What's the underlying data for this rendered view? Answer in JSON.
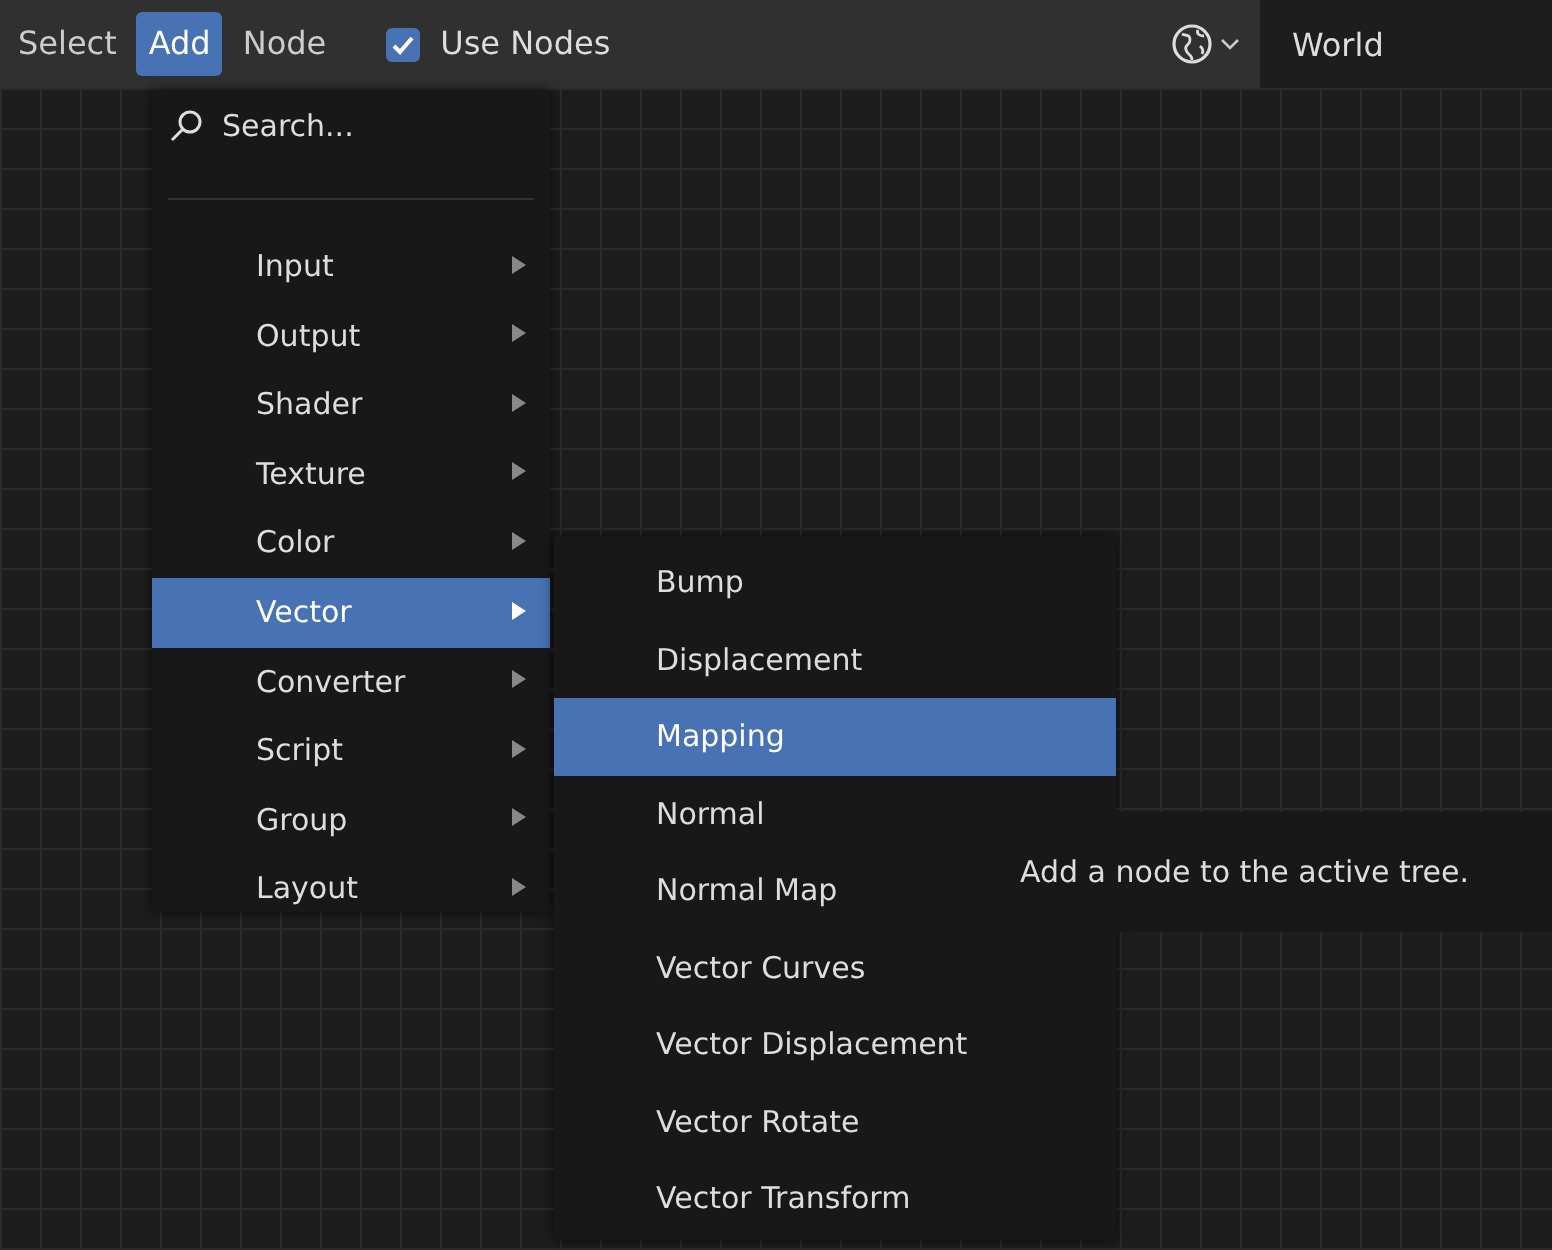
{
  "header": {
    "menus": [
      {
        "label": "Select",
        "selected": false
      },
      {
        "label": "Add",
        "selected": true
      },
      {
        "label": "Node",
        "selected": false
      }
    ],
    "use_nodes": {
      "label": "Use Nodes",
      "checked": true
    },
    "world_field": {
      "value": "World"
    }
  },
  "add_menu": {
    "search": {
      "label": "Search..."
    },
    "items": [
      {
        "label": "Input",
        "selected": false
      },
      {
        "label": "Output",
        "selected": false
      },
      {
        "label": "Shader",
        "selected": false
      },
      {
        "label": "Texture",
        "selected": false
      },
      {
        "label": "Color",
        "selected": false
      },
      {
        "label": "Vector",
        "selected": true
      },
      {
        "label": "Converter",
        "selected": false
      },
      {
        "label": "Script",
        "selected": false
      },
      {
        "label": "Group",
        "selected": false
      },
      {
        "label": "Layout",
        "selected": false
      }
    ]
  },
  "vector_menu": {
    "items": [
      {
        "label": "Bump",
        "selected": false
      },
      {
        "label": "Displacement",
        "selected": false
      },
      {
        "label": "Mapping",
        "selected": true
      },
      {
        "label": "Normal",
        "selected": false
      },
      {
        "label": "Normal Map",
        "selected": false
      },
      {
        "label": "Vector Curves",
        "selected": false
      },
      {
        "label": "Vector Displacement",
        "selected": false
      },
      {
        "label": "Vector Rotate",
        "selected": false
      },
      {
        "label": "Vector Transform",
        "selected": false
      }
    ]
  },
  "tooltip": {
    "text": "Add a node to the active tree."
  }
}
